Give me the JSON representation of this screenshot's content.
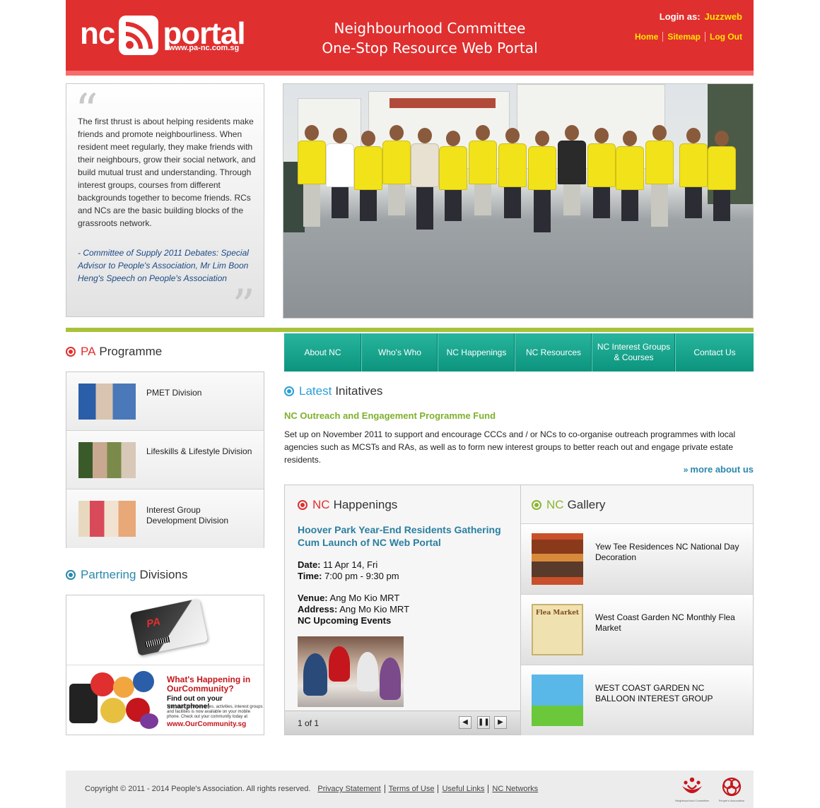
{
  "header": {
    "logo_nc": "nc",
    "logo_portal": "portal",
    "logo_url": "www.pa-nc.com.sg",
    "title_line1": "Neighbourhood Committee",
    "title_line2": "One-Stop Resource Web Portal",
    "login_label": "Login as:",
    "login_user": "Juzzweb",
    "links": [
      "Home",
      "Sitemap",
      "Log Out"
    ]
  },
  "quote": {
    "text": "The first thrust is about helping residents make friends and promote neighbourliness. When resident meet regularly, they make friends with their neighbours, grow their social network, and build mutual trust and understanding. Through interest groups, courses from different backgrounds together to become friends. RCs and NCs are the basic building blocks of the grassroots network.",
    "source": "- Committee of Supply 2011 Debates: Special Advisor to People's Association, Mr Lim Boon Heng's Speech on People's Association"
  },
  "pa_programme": {
    "title_highlight": "PA",
    "title_rest": "Programme",
    "items": [
      {
        "label": "PMET Division"
      },
      {
        "label": "Lifeskills & Lifestyle Division"
      },
      {
        "label": "Interest Group Development Division"
      }
    ]
  },
  "partnering": {
    "title_highlight": "Partnering",
    "title_rest": "Divisions",
    "card_text": "PA",
    "oc_heading": "What's Happening in OurCommunity?",
    "oc_sub": "Find out on your smartphone!",
    "oc_tiny": "The latest on PA courses, activities, interest groups and facilities is now available on your mobile phone. Check out your community today at",
    "oc_url": "www.OurCommunity.sg"
  },
  "nav": {
    "tabs": [
      "About NC",
      "Who's Who",
      "NC Happenings",
      "NC Resources",
      "NC Interest Groups & Courses",
      "Contact Us"
    ]
  },
  "latest": {
    "title_highlight": "Latest",
    "title_rest": "Initatives",
    "subtitle": "NC Outreach and Engagement Programme Fund",
    "text": "Set up on November 2011 to support and encourage CCCs and / or NCs to co-organise outreach programmes with local agencies such as MCSTs and RAs, as well as to form new interest groups to better reach out and engage private estate residents.",
    "more": "more about us"
  },
  "happenings": {
    "title_highlight": "NC",
    "title_rest": "Happenings",
    "event_title": "Hoover Park Year-End Residents Gathering Cum Launch of NC Web Portal",
    "date_label": "Date:",
    "date": "11 Apr 14, Fri",
    "time_label": "Time:",
    "time": "7:00 pm - 9:30 pm",
    "venue_label": "Venue:",
    "venue": "Ang Mo Kio MRT",
    "address_label": "Address:",
    "address": "Ang Mo Kio MRT",
    "upcoming": "NC Upcoming Events",
    "pager": "1 of 1"
  },
  "gallery": {
    "title_highlight": "NC",
    "title_rest": "Gallery",
    "items": [
      {
        "label": "Yew Tee Residences NC National Day Decoration"
      },
      {
        "label": "West Coast Garden NC Monthly Flea Market"
      },
      {
        "label": "WEST COAST GARDEN NC BALLOON INTEREST GROUP"
      }
    ],
    "flea_title": "Flea Market"
  },
  "footer": {
    "copyright": "Copyright © 2011 - 2014 People's Association. All rights reserved.",
    "links": [
      "Privacy Statement",
      "Terms of Use",
      "Useful Links",
      "NC Networks"
    ],
    "logo1_caption": "Neighbourhood Committee",
    "logo2_caption": "People's Association"
  },
  "colors": {
    "header_red": "#e02f2f",
    "accent_yellow": "#ffe600",
    "nav_teal": "#0c947e",
    "latest_blue": "#2a9fd6",
    "gallery_green": "#8ab52e"
  }
}
